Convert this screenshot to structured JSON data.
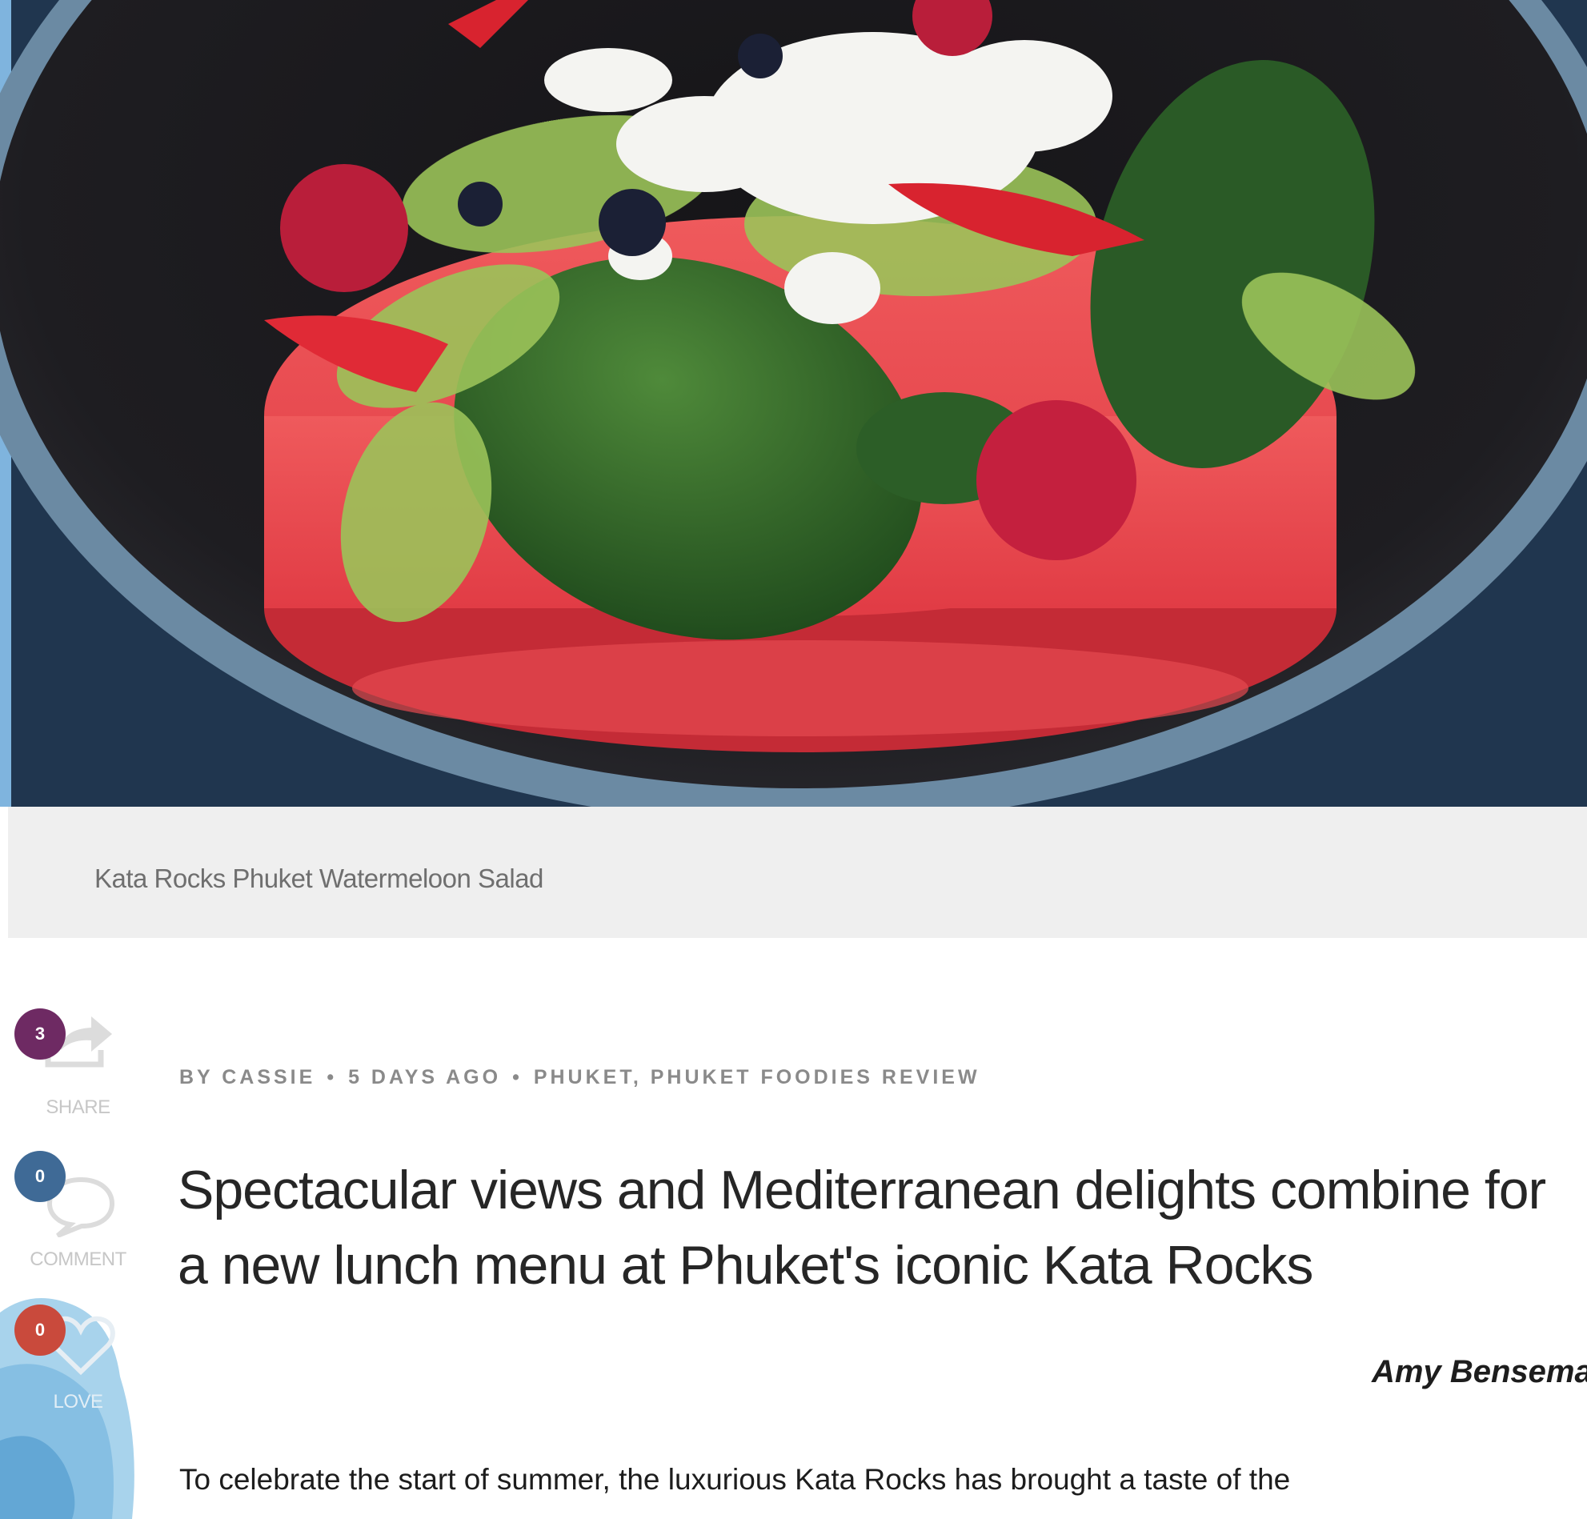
{
  "hero_image": {
    "description_icon": "photo-watermelon-salad",
    "caption": "Kata Rocks Phuket Watermeloon Salad"
  },
  "actions": [
    {
      "icon": "share-icon",
      "count": "3",
      "label": "SHARE",
      "color": "#6e2a63"
    },
    {
      "icon": "comment-icon",
      "count": "0",
      "label": "COMMENT",
      "color": "#3f6a96"
    },
    {
      "icon": "heart-icon",
      "count": "0",
      "label": "LOVE",
      "color": "#c94a3c"
    }
  ],
  "article": {
    "meta": {
      "author": "BY CASSIE",
      "date": "5 DAYS AGO",
      "categories": "PHUKET, PHUKET FOODIES REVIEW",
      "separator": "•"
    },
    "title": "Spectacular views and Mediterranean delights combine for a new lunch menu at Phuket's iconic Kata Rocks",
    "byline": "Amy Bensema",
    "intro": "To celebrate the start of summer, the luxurious Kata Rocks has brought a taste of the"
  }
}
